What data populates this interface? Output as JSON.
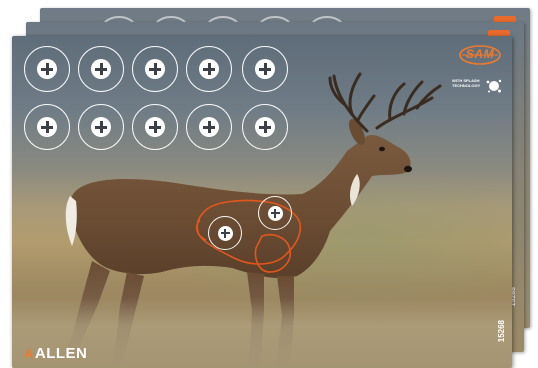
{
  "brand": {
    "name": "ALLEN",
    "mark": "A"
  },
  "sam_logo": {
    "text": "SAM"
  },
  "splatter": {
    "text": "WITH SPLASH TECHNOLOGY"
  },
  "product_code": "15268",
  "back_codes": [
    "15268",
    "15268"
  ],
  "grid": {
    "rows": 2,
    "columns": 5
  },
  "vital_targets": 2,
  "colors": {
    "accent": "#ef7a2c",
    "target": "#ffffff",
    "vital_outline": "#e3571d"
  }
}
